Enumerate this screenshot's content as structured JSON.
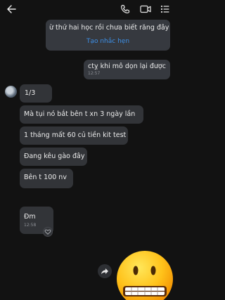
{
  "header": {
    "back": "back-icon",
    "call": "phone-icon",
    "video": "video-icon",
    "menu": "list-menu-icon"
  },
  "messages": {
    "m1": {
      "text": "ừ thứ hai học rồi chưa biết răng đây",
      "action": "Tạo nhắc hẹn"
    },
    "m2": {
      "text": "ctỵ khi mô dọn lại được",
      "time": "12:57"
    },
    "m3": {
      "text": "1/3"
    },
    "m4": {
      "text": "Mà tụi nó bắt bên t xn 3 ngày lần"
    },
    "m5": {
      "text": "1 tháng mất 60 củ tiền kit test"
    },
    "m6": {
      "text": "Đang kêu gào đây"
    },
    "m7": {
      "text": "Bên t 100 nv"
    },
    "m8": {
      "text": "Đm",
      "time": "12:58"
    }
  },
  "colors": {
    "background": "#121212",
    "bubble": "#323438",
    "link": "#3d8fe6"
  }
}
